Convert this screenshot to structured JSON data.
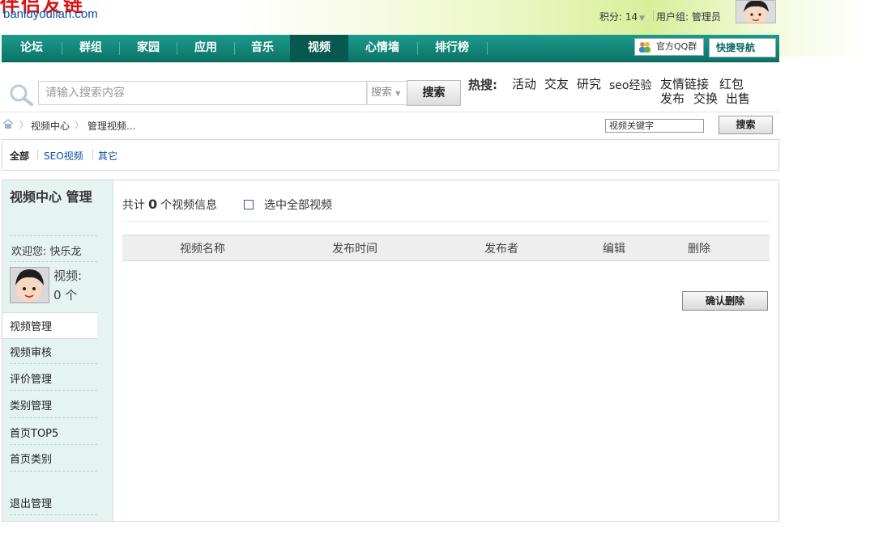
{
  "site": {
    "title": "伴侣友链",
    "domain": "banluyoulian.com"
  },
  "user_bar": {
    "score_label": "积分: 14",
    "user_group": "用户组: 管理员"
  },
  "nav": {
    "items": [
      "论坛",
      "群组",
      "家园",
      "应用",
      "音乐",
      "视频",
      "心情墙",
      "排行榜"
    ],
    "active": "视频",
    "qq_group": "官方QQ群",
    "quick_nav": "快捷导航"
  },
  "search": {
    "placeholder": "请输入搜索内容",
    "type": "搜索",
    "button": "搜索",
    "hot_label": "热搜:",
    "hot_terms": [
      "活动",
      "交友",
      "研究",
      "seo经验",
      "友情链接",
      "红包",
      "发布",
      "交换",
      "出售"
    ]
  },
  "breadcrumb": {
    "items": [
      "视频中心",
      "管理视频..."
    ],
    "search_value": "视频关键字",
    "search_button": "搜索"
  },
  "filters": {
    "items": [
      "全部",
      "SEO视频",
      "其它"
    ],
    "active": "全部"
  },
  "sidebar": {
    "title": "视频中心 管理",
    "welcome": "欢迎您: 快乐龙",
    "video_label": "视频:",
    "video_count": "0 个",
    "items": [
      "视频管理",
      "视频审核",
      "评价管理",
      "类别管理",
      "首页TOP5",
      "首页类别",
      "退出管理"
    ],
    "active": "视频管理"
  },
  "content": {
    "total_prefix": "共计",
    "total_count": "0",
    "total_suffix": "个视频信息",
    "select_all": "选中全部视频",
    "columns": [
      "视频名称",
      "发布时间",
      "发布者",
      "编辑",
      "删除"
    ],
    "confirm_delete": "确认删除"
  },
  "colors": {
    "nav_bg": "#0b7467",
    "nav_active": "#07594f",
    "sidebar_bg": "#e5f4f1",
    "link_blue": "#0a4fa0"
  }
}
